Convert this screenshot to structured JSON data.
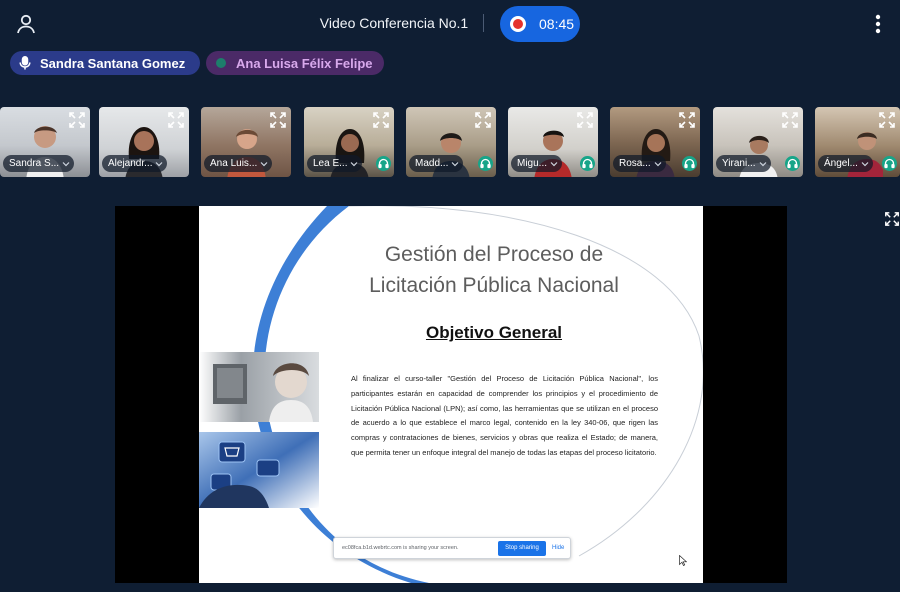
{
  "header": {
    "title": "Video Conferencia No.1",
    "timer": "08:45",
    "icons": {
      "user": "user-icon",
      "record": "record-icon",
      "more": "more-vertical-icon"
    }
  },
  "speakers": [
    {
      "name": "Sandra Santana Gomez",
      "icon": "microphone-icon"
    },
    {
      "name": "Ana Luisa Félix Felipe",
      "icon": "speaking-dot-icon"
    }
  ],
  "participants": [
    {
      "label": "Sandra S...",
      "headset": false
    },
    {
      "label": "Alejandr...",
      "headset": false
    },
    {
      "label": "Ana Luis...",
      "headset": false
    },
    {
      "label": "Lea E...",
      "headset": true
    },
    {
      "label": "Madd...",
      "headset": true
    },
    {
      "label": "Migu...",
      "headset": true
    },
    {
      "label": "Rosa...",
      "headset": true
    },
    {
      "label": "Yirani...",
      "headset": true
    },
    {
      "label": "Ángel...",
      "headset": true
    }
  ],
  "slide": {
    "title_line1": "Gestión del Proceso de",
    "title_line2": "Licitación Pública Nacional",
    "subtitle": "Objetivo General",
    "body": "Al finalizar el curso-taller \"Gestión del Proceso de Licitación Pública Nacional\", los participantes estarán en capacidad de comprender los principios y el procedimiento de Licitación Pública Nacional (LPN); así como, las herramientas que se utilizan en el proceso de acuerdo a lo que establece el marco legal, contenido en la ley 340-06, que rigen las compras y contrataciones de bienes, servicios y obras que realiza el Estado; de manera, que permita tener un enfoque integral del manejo de todas las etapas del proceso licitatorio."
  },
  "share_bar": {
    "message": "ec08fca.b1d.webrtc.com is sharing your screen.",
    "stop_label": "Stop sharing",
    "hide_label": "Hide"
  },
  "colors": {
    "background": "#0f1e33",
    "timer_pill": "#1766e0",
    "record": "#e5322d",
    "chip_primary": "#2b3b8a",
    "chip_secondary": "#4b2a67",
    "headset": "#17a589",
    "slide_arc": "#3d7fd6"
  }
}
